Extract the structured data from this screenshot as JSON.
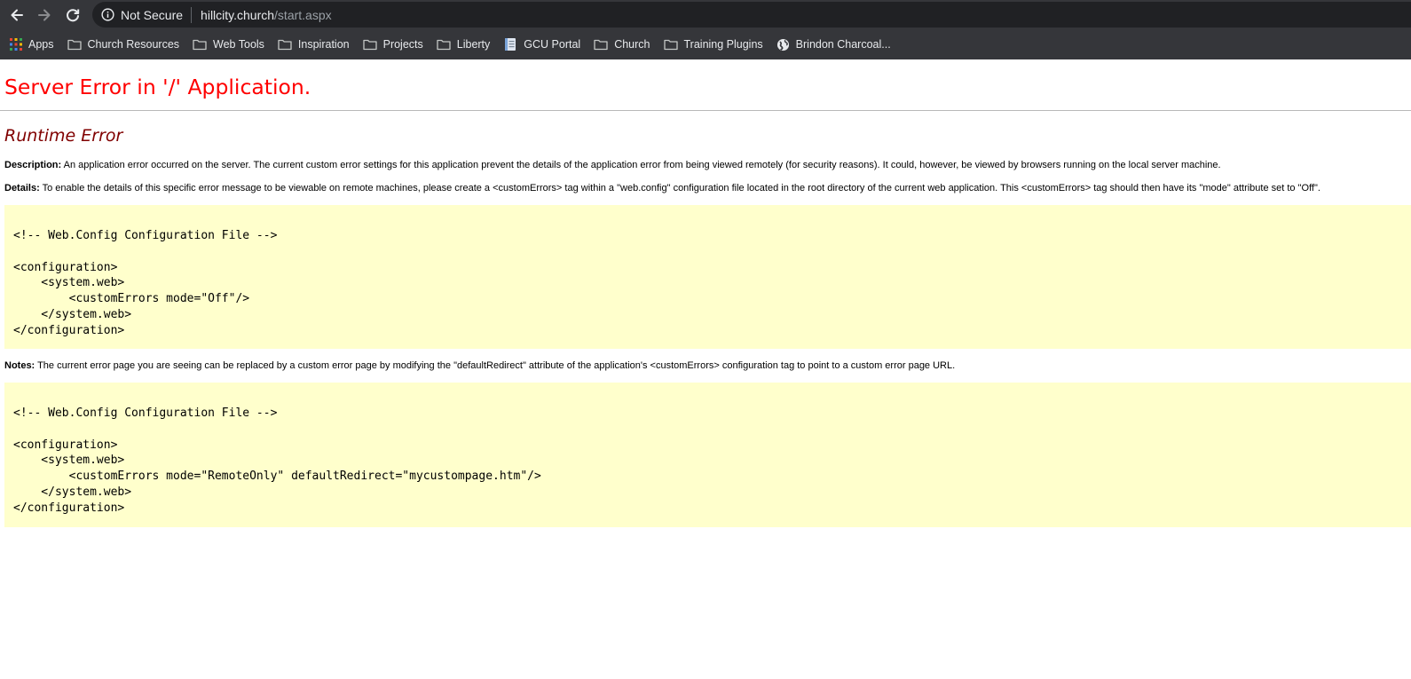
{
  "browser": {
    "security_label": "Not Secure",
    "url_host": "hillcity.church",
    "url_path": "/start.aspx",
    "bookmarks": [
      {
        "label": "Apps",
        "icon": "apps-grid-icon"
      },
      {
        "label": "Church Resources",
        "icon": "folder-icon"
      },
      {
        "label": "Web Tools",
        "icon": "folder-icon"
      },
      {
        "label": "Inspiration",
        "icon": "folder-icon"
      },
      {
        "label": "Projects",
        "icon": "folder-icon"
      },
      {
        "label": "Liberty",
        "icon": "folder-icon"
      },
      {
        "label": "GCU Portal",
        "icon": "document-icon"
      },
      {
        "label": "Church",
        "icon": "folder-icon"
      },
      {
        "label": "Training Plugins",
        "icon": "folder-icon"
      },
      {
        "label": "Brindon Charcoal...",
        "icon": "globe-icon"
      }
    ]
  },
  "page": {
    "title": "Server Error in '/' Application.",
    "subtitle": "Runtime Error",
    "description": {
      "label": "Description:",
      "text": " An application error occurred on the server. The current custom error settings for this application prevent the details of the application error from being viewed remotely (for security reasons). It could, however, be viewed by browsers running on the local server machine."
    },
    "details": {
      "label": "Details:",
      "text": " To enable the details of this specific error message to be viewable on remote machines, please create a <customErrors> tag within a \"web.config\" configuration file located in the root directory of the current web application. This <customErrors> tag should then have its \"mode\" attribute set to \"Off\"."
    },
    "code1": [
      "<!-- Web.Config Configuration File -->",
      "",
      "<configuration>",
      "    <system.web>",
      "        <customErrors mode=\"Off\"/>",
      "    </system.web>",
      "</configuration>"
    ],
    "notes": {
      "label": "Notes:",
      "text": " The current error page you are seeing can be replaced by a custom error page by modifying the \"defaultRedirect\" attribute of the application's <customErrors> configuration tag to point to a custom error page URL."
    },
    "code2": [
      "<!-- Web.Config Configuration File -->",
      "",
      "<configuration>",
      "    <system.web>",
      "        <customErrors mode=\"RemoteOnly\" defaultRedirect=\"mycustompage.htm\"/>",
      "    </system.web>",
      "</configuration>"
    ]
  }
}
